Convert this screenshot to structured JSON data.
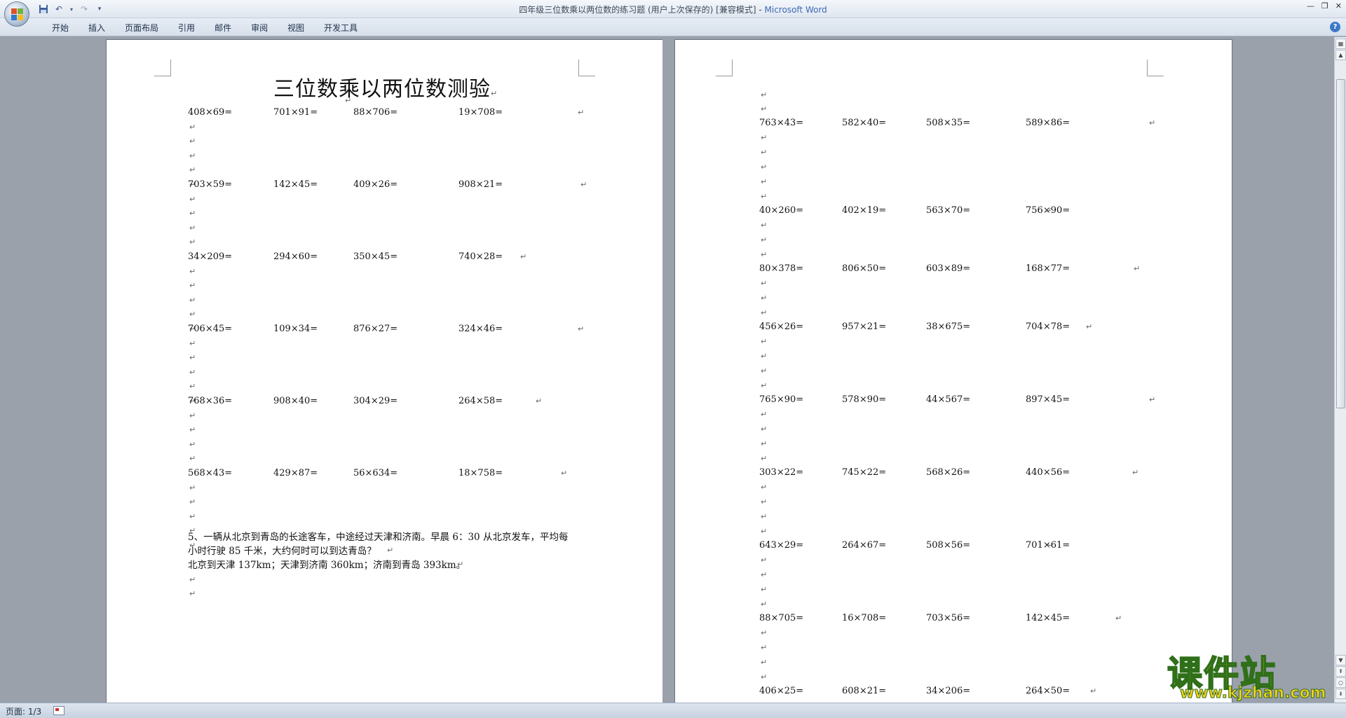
{
  "window": {
    "title": "四年级三位数乘以两位数的练习题 (用户上次保存的) [兼容模式] - ",
    "app_name": "Microsoft Word"
  },
  "quick_access": [
    {
      "name": "save-icon",
      "glyph": "💾"
    },
    {
      "name": "undo-icon",
      "glyph": "↶"
    },
    {
      "name": "redo-icon",
      "glyph": "↷"
    },
    {
      "name": "customize-qat-icon",
      "glyph": "▾"
    }
  ],
  "ribbon": {
    "tabs": [
      "开始",
      "插入",
      "页面布局",
      "引用",
      "邮件",
      "审阅",
      "视图",
      "开发工具"
    ]
  },
  "page1": {
    "title": "三位数乘以两位数测验",
    "rows": [
      [
        "408×69=",
        "701×91=",
        "88×706=",
        "19×708="
      ],
      [
        "703×59=",
        "142×45=",
        "409×26=",
        "908×21="
      ],
      [
        "34×209=",
        "294×60=",
        "350×45=",
        "740×28="
      ],
      [
        "706×45=",
        "109×34=",
        "876×27=",
        "324×46="
      ],
      [
        "768×36=",
        "908×40=",
        "304×29=",
        "264×58="
      ],
      [
        "568×43=",
        "429×87=",
        "56×634=",
        "18×758="
      ]
    ],
    "word_problem": [
      "5、一辆从北京到青岛的长途客车，中途经过天津和济南。早晨 6：30 从北京发车，平均每",
      "小时行驶 85 千米，大约何时可以到达青岛？",
      "北京到天津 137km；天津到济南 360km；济南到青岛 393km。"
    ]
  },
  "page2": {
    "rows": [
      [
        "763×43=",
        "582×40=",
        "508×35=",
        "589×86="
      ],
      [
        "40×260=",
        "402×19=",
        "563×70=",
        "756×90="
      ],
      [
        "80×378=",
        "806×50=",
        "603×89=",
        "168×77="
      ],
      [
        "456×26=",
        "957×21=",
        "38×675=",
        "704×78="
      ],
      [
        "765×90=",
        "578×90=",
        "44×567=",
        "897×45="
      ],
      [
        "303×22=",
        "745×22=",
        "568×26=",
        "440×56="
      ],
      [
        "643×29=",
        "264×67=",
        "508×56=",
        "701×61="
      ],
      [
        "88×705=",
        "16×708=",
        "703×56=",
        "142×45="
      ],
      [
        "406×25=",
        "608×21=",
        "34×206=",
        "264×50="
      ]
    ]
  },
  "paragraph_mark": "↵",
  "statusbar": {
    "page": "页面: 1/3"
  },
  "watermark": {
    "text": "课件站",
    "url": "www.kjzhan.com"
  }
}
